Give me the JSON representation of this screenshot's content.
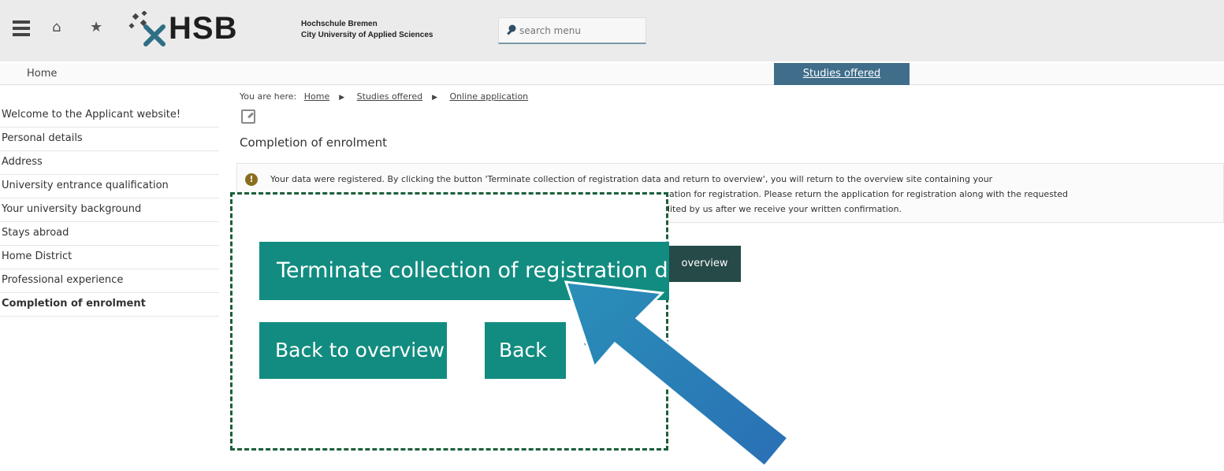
{
  "header": {
    "logo_text": "HSB",
    "uni_name_line1": "Hochschule Bremen",
    "uni_name_line2": "City University of Applied Sciences",
    "search_placeholder": "search menu",
    "icons": [
      "menu-icon",
      "home-icon",
      "star-icon",
      "search-icon"
    ]
  },
  "topnav": {
    "home": "Home",
    "studies_offered": "Studies offered"
  },
  "sidebar": {
    "items": [
      {
        "label": "Welcome to the Applicant website!"
      },
      {
        "label": "Personal details"
      },
      {
        "label": "Address"
      },
      {
        "label": "University entrance qualification"
      },
      {
        "label": "Your university background"
      },
      {
        "label": "Stays abroad"
      },
      {
        "label": "Home District"
      },
      {
        "label": "Professional experience"
      },
      {
        "label": "Completion of enrolment",
        "active": true
      }
    ]
  },
  "breadcrumb": {
    "prefix": "You are here:",
    "items": [
      "Home",
      "Studies offered",
      "Online application"
    ]
  },
  "main": {
    "title": "Completion of enrolment",
    "info_line1": "Your data were registered. By clicking the button 'Terminate collection of registration data and return to overview', you will return to the overview site containing your",
    "info_line2": "cation for registration. Please return the application for registration along with the requested",
    "info_line3": "dited by us after we receive your written confirmation.",
    "overview_btn_tail": "overview"
  },
  "zoom": {
    "terminate_button": "Terminate collection of registration d",
    "back_to_overview_button": "Back to overview",
    "back_button": "Back"
  },
  "colors": {
    "teal_button": "#128c80",
    "nav_active": "#3f6d8a",
    "arrow": "#2a74b3",
    "callout_border": "#1b5e3a"
  }
}
